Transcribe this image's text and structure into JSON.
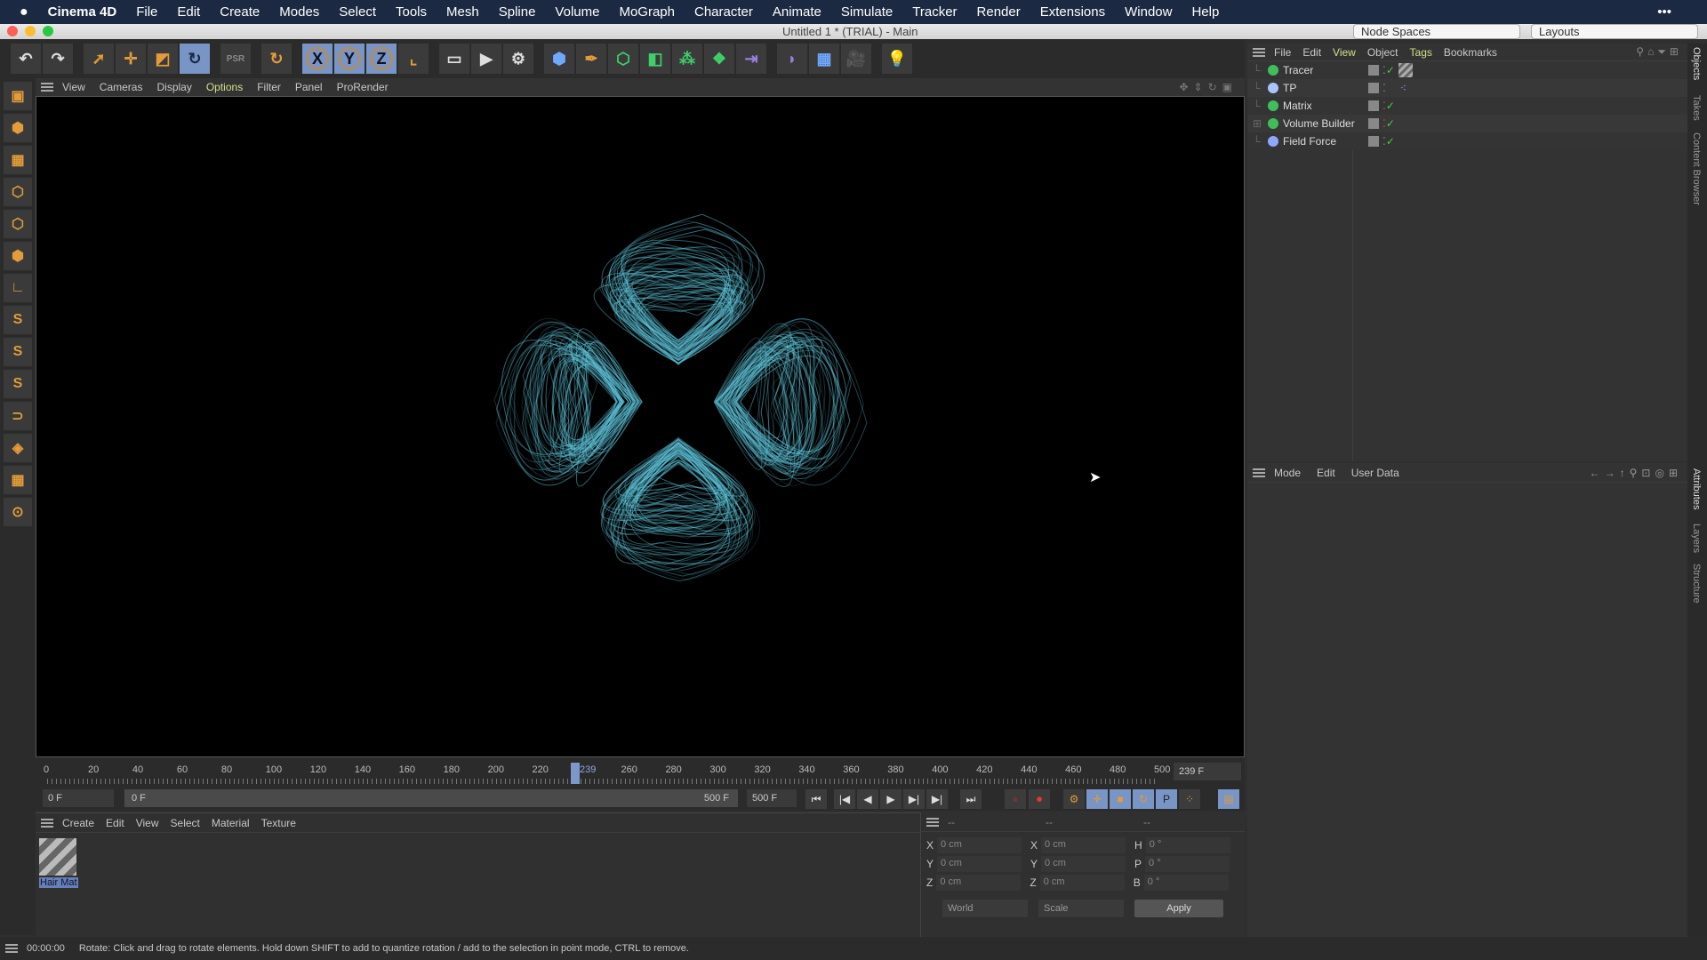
{
  "menubar": {
    "apple": "",
    "app": "Cinema 4D",
    "items": [
      "File",
      "Edit",
      "Create",
      "Modes",
      "Select",
      "Tools",
      "Mesh",
      "Spline",
      "Volume",
      "MoGraph",
      "Character",
      "Animate",
      "Simulate",
      "Tracker",
      "Render",
      "Extensions",
      "Window",
      "Help"
    ]
  },
  "window": {
    "title": "Untitled 1 * (TRIAL) - Main",
    "node_spaces": "Node Spaces",
    "layouts": "Layouts"
  },
  "toolbar": {
    "icons": [
      "undo-icon",
      "redo-icon",
      "select-icon",
      "move-icon",
      "scale-icon",
      "rotate-icon",
      "psr-icon",
      "recent-tool-icon",
      "x-axis-icon",
      "y-axis-icon",
      "z-axis-icon",
      "coordinate-system-icon",
      "render-view-icon",
      "render-picture-viewer-icon",
      "render-settings-icon",
      "cube-icon",
      "pen-icon",
      "subdivision-icon",
      "extrude-icon",
      "cloner-icon",
      "array-icon",
      "symmetry-icon",
      "deformer-icon",
      "floor-icon",
      "camera-icon",
      "light-icon"
    ],
    "labels": {
      "x": "X",
      "y": "Y",
      "z": "Z",
      "psr": "PSR"
    }
  },
  "left_tools": [
    "make-editable-icon",
    "model-mode-icon",
    "texture-mode-icon",
    "point-mode-icon",
    "edge-mode-icon",
    "polygon-mode-icon",
    "axis-icon",
    "snap-icon",
    "snap-settings-icon",
    "solo-icon",
    "magnet-icon",
    "workplane-icon",
    "grid-icon",
    "lock-icon"
  ],
  "viewport": {
    "menu": [
      "View",
      "Cameras",
      "Display",
      "Options",
      "Filter",
      "Panel",
      "ProRender"
    ],
    "active_menu": "Options",
    "particle_color": "#5fc6dc"
  },
  "timeline": {
    "ticks": [
      0,
      20,
      40,
      60,
      80,
      100,
      120,
      140,
      160,
      180,
      200,
      220,
      240,
      260,
      280,
      300,
      320,
      340,
      360,
      380,
      400,
      420,
      440,
      460,
      480,
      500
    ],
    "current_frame": 239,
    "current_label": "239",
    "frame_field": "239 F",
    "start": "0 F",
    "range_start": "0 F",
    "range_end": "500 F",
    "end": "500 F"
  },
  "material_manager": {
    "menu": [
      "Create",
      "Edit",
      "View",
      "Select",
      "Material",
      "Texture"
    ],
    "materials": [
      {
        "name": "Hair Mat"
      }
    ]
  },
  "coordinates": {
    "headers": [
      "--",
      "--",
      "--"
    ],
    "rows": [
      {
        "a": "X",
        "av": "0 cm",
        "b": "X",
        "bv": "0 cm",
        "c": "H",
        "cv": "0 °"
      },
      {
        "a": "Y",
        "av": "0 cm",
        "b": "Y",
        "bv": "0 cm",
        "c": "P",
        "cv": "0 °"
      },
      {
        "a": "Z",
        "av": "0 cm",
        "b": "Z",
        "bv": "0 cm",
        "c": "B",
        "cv": "0 °"
      }
    ],
    "space": "World",
    "mode": "Scale",
    "apply": "Apply"
  },
  "object_manager": {
    "menu": [
      "File",
      "Edit",
      "View",
      "Object",
      "Tags",
      "Bookmarks"
    ],
    "highlight": [
      "View",
      "Tags"
    ],
    "objects": [
      {
        "name": "Tracer",
        "icon": "tracer-icon",
        "color": "#3fbf5a"
      },
      {
        "name": "TP",
        "icon": "thinking-particles-icon",
        "color": "#aac4ff"
      },
      {
        "name": "Matrix",
        "icon": "matrix-icon",
        "color": "#3fbf5a"
      },
      {
        "name": "Volume Builder",
        "icon": "volume-builder-icon",
        "color": "#3fbf5a"
      },
      {
        "name": "Field Force",
        "icon": "field-force-icon",
        "color": "#8fa6ff"
      }
    ]
  },
  "attributes": {
    "menu": [
      "Mode",
      "Edit",
      "User Data"
    ]
  },
  "side_tabs": {
    "top": [
      "Objects",
      "Takes",
      "Content Browser"
    ],
    "bottom": [
      "Attributes",
      "Layers",
      "Structure"
    ]
  },
  "status": {
    "time": "00:00:00",
    "message": "Rotate: Click and drag to rotate elements. Hold down SHIFT to add to quantize rotation / add to the selection in point mode, CTRL to remove."
  }
}
